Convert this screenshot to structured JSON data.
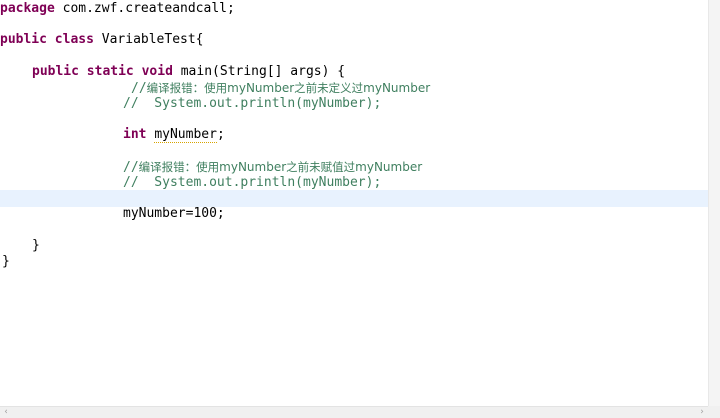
{
  "editor": {
    "lines": {
      "l1": {
        "kw": "package",
        "rest": " com.zwf.createandcall;"
      },
      "l3": {
        "kw1": "public",
        "kw2": "class",
        "rest": " VariableTest{"
      },
      "l5": {
        "kw1": "public",
        "kw2": "static",
        "kw3": "void",
        "rest": " main(String[] args) {"
      },
      "l6": {
        "slashes": "//",
        "cn1": "编译报错：使用",
        "id1": "myNumber",
        "cn2": "之前未定义过",
        "id2": "myNumber"
      },
      "l7": {
        "code": "//  System.out.println(myNumber);"
      },
      "l9": {
        "kw": "int",
        "space": " ",
        "var": "myNumber",
        "semi": ";"
      },
      "l11": {
        "slashes": "//",
        "cn1": "编译报错：使用",
        "id1": "myNumber",
        "cn2": "之前未赋值过",
        "id2": "myNumber"
      },
      "l12": {
        "code": "//  System.out.println(myNumber);"
      },
      "l14": {
        "code": "myNumber=100;"
      },
      "l16": {
        "code": "}"
      },
      "l17": {
        "code": "}"
      }
    }
  },
  "scrollbar": {
    "left_arrow": "‹",
    "right_arrow": "›"
  }
}
